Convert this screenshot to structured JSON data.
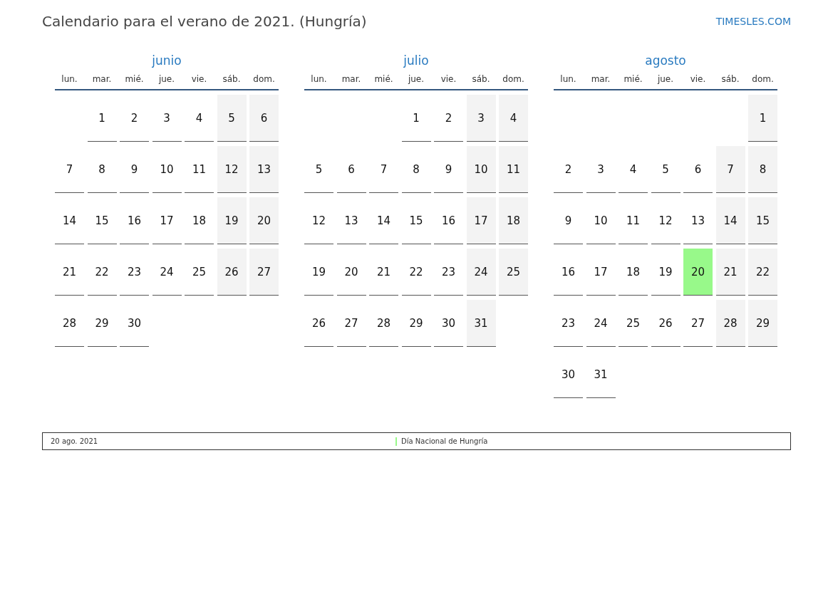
{
  "title": "Calendario para el verano de 2021. (Hungría)",
  "site": "TIMESLES.COM",
  "months": [
    {
      "name": "junio",
      "weekdays": [
        "lun.",
        "mar.",
        "mié.",
        "jue.",
        "vie.",
        "sáb.",
        "dom."
      ],
      "weeks": [
        [
          {
            "kind": "empty"
          },
          {
            "day": "1",
            "kind": "workday"
          },
          {
            "day": "2",
            "kind": "workday"
          },
          {
            "day": "3",
            "kind": "workday"
          },
          {
            "day": "4",
            "kind": "workday"
          },
          {
            "day": "5",
            "kind": "weekend"
          },
          {
            "day": "6",
            "kind": "weekend"
          }
        ],
        [
          {
            "day": "7",
            "kind": "workday"
          },
          {
            "day": "8",
            "kind": "workday"
          },
          {
            "day": "9",
            "kind": "workday"
          },
          {
            "day": "10",
            "kind": "workday"
          },
          {
            "day": "11",
            "kind": "workday"
          },
          {
            "day": "12",
            "kind": "weekend"
          },
          {
            "day": "13",
            "kind": "weekend"
          }
        ],
        [
          {
            "day": "14",
            "kind": "workday"
          },
          {
            "day": "15",
            "kind": "workday"
          },
          {
            "day": "16",
            "kind": "workday"
          },
          {
            "day": "17",
            "kind": "workday"
          },
          {
            "day": "18",
            "kind": "workday"
          },
          {
            "day": "19",
            "kind": "weekend"
          },
          {
            "day": "20",
            "kind": "weekend"
          }
        ],
        [
          {
            "day": "21",
            "kind": "workday"
          },
          {
            "day": "22",
            "kind": "workday"
          },
          {
            "day": "23",
            "kind": "workday"
          },
          {
            "day": "24",
            "kind": "workday"
          },
          {
            "day": "25",
            "kind": "workday"
          },
          {
            "day": "26",
            "kind": "weekend"
          },
          {
            "day": "27",
            "kind": "weekend"
          }
        ],
        [
          {
            "day": "28",
            "kind": "workday"
          },
          {
            "day": "29",
            "kind": "workday"
          },
          {
            "day": "30",
            "kind": "workday"
          },
          {
            "kind": "empty"
          },
          {
            "kind": "empty"
          },
          {
            "kind": "empty"
          },
          {
            "kind": "empty"
          }
        ]
      ]
    },
    {
      "name": "julio",
      "weekdays": [
        "lun.",
        "mar.",
        "mié.",
        "jue.",
        "vie.",
        "sáb.",
        "dom."
      ],
      "weeks": [
        [
          {
            "kind": "empty"
          },
          {
            "kind": "empty"
          },
          {
            "kind": "empty"
          },
          {
            "day": "1",
            "kind": "workday"
          },
          {
            "day": "2",
            "kind": "workday"
          },
          {
            "day": "3",
            "kind": "weekend"
          },
          {
            "day": "4",
            "kind": "weekend"
          }
        ],
        [
          {
            "day": "5",
            "kind": "workday"
          },
          {
            "day": "6",
            "kind": "workday"
          },
          {
            "day": "7",
            "kind": "workday"
          },
          {
            "day": "8",
            "kind": "workday"
          },
          {
            "day": "9",
            "kind": "workday"
          },
          {
            "day": "10",
            "kind": "weekend"
          },
          {
            "day": "11",
            "kind": "weekend"
          }
        ],
        [
          {
            "day": "12",
            "kind": "workday"
          },
          {
            "day": "13",
            "kind": "workday"
          },
          {
            "day": "14",
            "kind": "workday"
          },
          {
            "day": "15",
            "kind": "workday"
          },
          {
            "day": "16",
            "kind": "workday"
          },
          {
            "day": "17",
            "kind": "weekend"
          },
          {
            "day": "18",
            "kind": "weekend"
          }
        ],
        [
          {
            "day": "19",
            "kind": "workday"
          },
          {
            "day": "20",
            "kind": "workday"
          },
          {
            "day": "21",
            "kind": "workday"
          },
          {
            "day": "22",
            "kind": "workday"
          },
          {
            "day": "23",
            "kind": "workday"
          },
          {
            "day": "24",
            "kind": "weekend"
          },
          {
            "day": "25",
            "kind": "weekend"
          }
        ],
        [
          {
            "day": "26",
            "kind": "workday"
          },
          {
            "day": "27",
            "kind": "workday"
          },
          {
            "day": "28",
            "kind": "workday"
          },
          {
            "day": "29",
            "kind": "workday"
          },
          {
            "day": "30",
            "kind": "workday"
          },
          {
            "day": "31",
            "kind": "weekend"
          },
          {
            "kind": "empty"
          }
        ]
      ]
    },
    {
      "name": "agosto",
      "weekdays": [
        "lun.",
        "mar.",
        "mié.",
        "jue.",
        "vie.",
        "sáb.",
        "dom."
      ],
      "weeks": [
        [
          {
            "kind": "empty"
          },
          {
            "kind": "empty"
          },
          {
            "kind": "empty"
          },
          {
            "kind": "empty"
          },
          {
            "kind": "empty"
          },
          {
            "kind": "empty"
          },
          {
            "day": "1",
            "kind": "weekend"
          }
        ],
        [
          {
            "day": "2",
            "kind": "workday"
          },
          {
            "day": "3",
            "kind": "workday"
          },
          {
            "day": "4",
            "kind": "workday"
          },
          {
            "day": "5",
            "kind": "workday"
          },
          {
            "day": "6",
            "kind": "workday"
          },
          {
            "day": "7",
            "kind": "weekend"
          },
          {
            "day": "8",
            "kind": "weekend"
          }
        ],
        [
          {
            "day": "9",
            "kind": "workday"
          },
          {
            "day": "10",
            "kind": "workday"
          },
          {
            "day": "11",
            "kind": "workday"
          },
          {
            "day": "12",
            "kind": "workday"
          },
          {
            "day": "13",
            "kind": "workday"
          },
          {
            "day": "14",
            "kind": "weekend"
          },
          {
            "day": "15",
            "kind": "weekend"
          }
        ],
        [
          {
            "day": "16",
            "kind": "workday"
          },
          {
            "day": "17",
            "kind": "workday"
          },
          {
            "day": "18",
            "kind": "workday"
          },
          {
            "day": "19",
            "kind": "workday"
          },
          {
            "day": "20",
            "kind": "holiday"
          },
          {
            "day": "21",
            "kind": "weekend"
          },
          {
            "day": "22",
            "kind": "weekend"
          }
        ],
        [
          {
            "day": "23",
            "kind": "workday"
          },
          {
            "day": "24",
            "kind": "workday"
          },
          {
            "day": "25",
            "kind": "workday"
          },
          {
            "day": "26",
            "kind": "workday"
          },
          {
            "day": "27",
            "kind": "workday"
          },
          {
            "day": "28",
            "kind": "weekend"
          },
          {
            "day": "29",
            "kind": "weekend"
          }
        ],
        [
          {
            "day": "30",
            "kind": "workday"
          },
          {
            "day": "31",
            "kind": "workday"
          },
          {
            "kind": "empty"
          },
          {
            "kind": "empty"
          },
          {
            "kind": "empty"
          },
          {
            "kind": "empty"
          },
          {
            "kind": "empty"
          }
        ]
      ]
    }
  ],
  "holidays": [
    {
      "date": "20 ago. 2021",
      "name": "Día Nacional de Hungría",
      "color": "#98f98a"
    }
  ]
}
